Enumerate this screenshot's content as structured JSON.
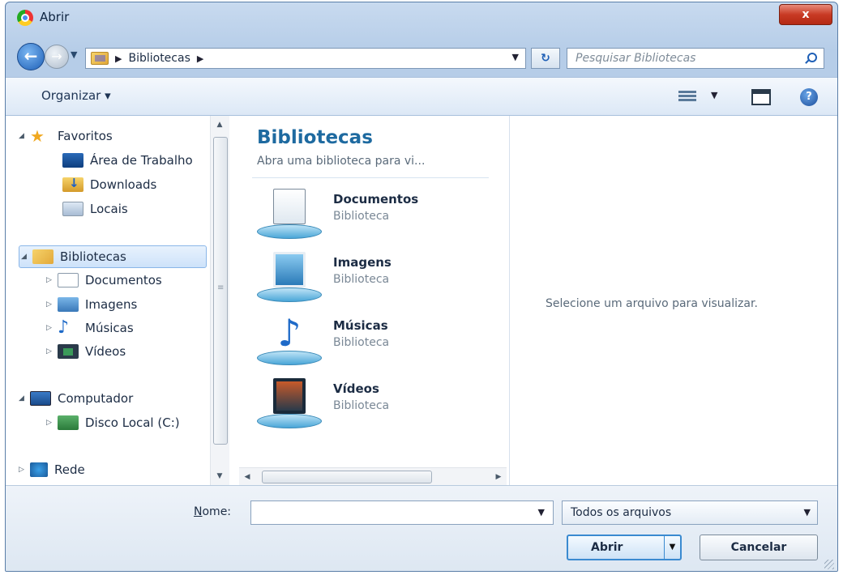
{
  "window": {
    "title": "Abrir",
    "close_label": "x"
  },
  "nav": {
    "back_glyph": "←",
    "forward_glyph": "→",
    "breadcrumb": [
      "Bibliotecas"
    ],
    "search_placeholder": "Pesquisar Bibliotecas"
  },
  "toolbar": {
    "organize_label": "Organizar ▾",
    "help_label": "?"
  },
  "sidebar": {
    "favorites": {
      "label": "Favoritos",
      "items": [
        "Área de Trabalho",
        "Downloads",
        "Locais"
      ]
    },
    "libraries": {
      "label": "Bibliotecas",
      "items": [
        "Documentos",
        "Imagens",
        "Músicas",
        "Vídeos"
      ]
    },
    "computer": {
      "label": "Computador",
      "items": [
        "Disco Local (C:)"
      ]
    },
    "network": {
      "label": "Rede"
    }
  },
  "library_pane": {
    "title": "Bibliotecas",
    "subtitle": "Abra uma biblioteca para vi...",
    "entries": [
      {
        "name": "Documentos",
        "type": "Biblioteca",
        "icon": "documents-library-icon"
      },
      {
        "name": "Imagens",
        "type": "Biblioteca",
        "icon": "pictures-library-icon"
      },
      {
        "name": "Músicas",
        "type": "Biblioteca",
        "icon": "music-library-icon"
      },
      {
        "name": "Vídeos",
        "type": "Biblioteca",
        "icon": "videos-library-icon"
      }
    ]
  },
  "preview": {
    "message": "Selecione um arquivo para visualizar."
  },
  "footer": {
    "name_label_prefix": "N",
    "name_label_rest": "ome:",
    "name_value": "",
    "filter_value": "Todos os arquivos",
    "open_label": "Abrir",
    "cancel_label": "Cancelar"
  },
  "colors": {
    "accent": "#1e6aa0",
    "titlebar": "#c8daef",
    "close": "#c83a24"
  }
}
